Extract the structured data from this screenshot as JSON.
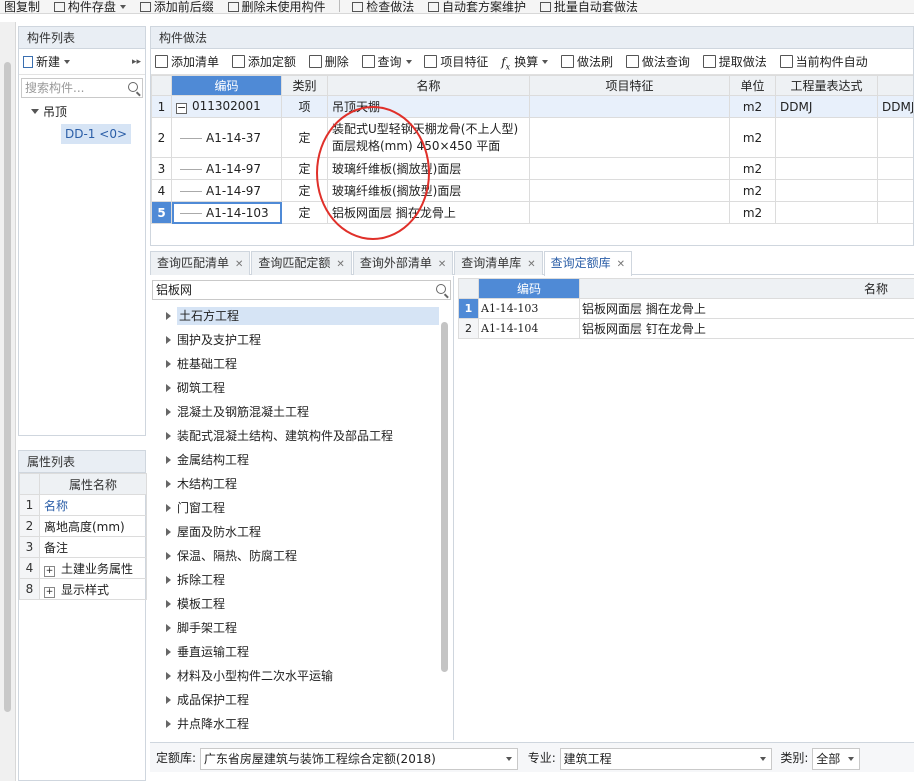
{
  "top_toolbar": [
    "图复制",
    "构件存盘",
    "添加前后缀",
    "删除未使用构件",
    "检查做法",
    "自动套方案维护",
    "批量自动套做法"
  ],
  "component_list": {
    "title": "构件列表",
    "new_label": "新建",
    "search_placeholder": "搜索构件...",
    "tree_root": "吊顶",
    "tree_child": "DD-1 <0>"
  },
  "property_list": {
    "title": "属性列表",
    "header": "属性名称",
    "rows": [
      {
        "n": "1",
        "label": "名称"
      },
      {
        "n": "2",
        "label": "离地高度(mm)"
      },
      {
        "n": "3",
        "label": "备注"
      },
      {
        "n": "4",
        "label": "土建业务属性"
      },
      {
        "n": "8",
        "label": "显示样式"
      }
    ]
  },
  "practice": {
    "title": "构件做法",
    "tools": [
      "添加清单",
      "添加定额",
      "删除",
      "查询",
      "项目特征",
      "换算",
      "做法刷",
      "做法查询",
      "提取做法",
      "当前构件自动"
    ],
    "headers": [
      "编码",
      "类别",
      "名称",
      "项目特征",
      "单位",
      "工程量表达式",
      ""
    ],
    "rows": [
      {
        "n": "1",
        "code": "011302001",
        "type": "项",
        "name": "吊顶天棚",
        "name2": "",
        "unit": "m2",
        "expr": "DDMJ",
        "extra": "DDMJ"
      },
      {
        "n": "2",
        "code": "A1-14-37",
        "type": "定",
        "name": "装配式U型轻钢天棚龙骨(不上人型)",
        "name2": "面层规格(mm) 450×450 平面",
        "unit": "m2",
        "expr": "",
        "extra": ""
      },
      {
        "n": "3",
        "code": "A1-14-97",
        "type": "定",
        "name": "玻璃纤维板(搁放型)面层",
        "name2": "",
        "unit": "m2",
        "expr": "",
        "extra": ""
      },
      {
        "n": "4",
        "code": "A1-14-97",
        "type": "定",
        "name": "玻璃纤维板(搁放型)面层",
        "name2": "",
        "unit": "m2",
        "expr": "",
        "extra": ""
      },
      {
        "n": "5",
        "code": "A1-14-103",
        "type": "定",
        "name": "铝板网面层 搁在龙骨上",
        "name2": "",
        "unit": "m2",
        "expr": "",
        "extra": ""
      }
    ]
  },
  "tabs": [
    "查询匹配清单",
    "查询匹配定额",
    "查询外部清单",
    "查询清单库",
    "查询定额库"
  ],
  "query": {
    "search_value": "铝板网",
    "categories": [
      "土石方工程",
      "围护及支护工程",
      "桩基础工程",
      "砌筑工程",
      "混凝土及钢筋混凝土工程",
      "装配式混凝土结构、建筑构件及部品工程",
      "金属结构工程",
      "木结构工程",
      "门窗工程",
      "屋面及防水工程",
      "保温、隔热、防腐工程",
      "拆除工程",
      "模板工程",
      "脚手架工程",
      "垂直运输工程",
      "材料及小型构件二次水平运输",
      "成品保护工程",
      "井点降水工程"
    ]
  },
  "quota": {
    "headers": [
      "编码",
      "名称"
    ],
    "rows": [
      {
        "n": "1",
        "code": "A1-14-103",
        "name": "铝板网面层 搁在龙骨上"
      },
      {
        "n": "2",
        "code": "A1-14-104",
        "name": "铝板网面层 钉在龙骨上"
      }
    ]
  },
  "status": {
    "lib_label": "定额库:",
    "lib_value": "广东省房屋建筑与装饰工程综合定额(2018)",
    "major_label": "专业:",
    "major_value": "建筑工程",
    "category_label": "类别:",
    "category_value": "全部"
  },
  "colors": {
    "accent": "#4f8ad6",
    "annotation": "#e0302a"
  }
}
